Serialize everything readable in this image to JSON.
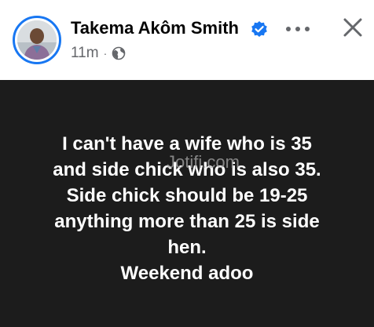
{
  "post": {
    "author_name": "Takema Akôm Smith",
    "timestamp": "11m",
    "separator": "·",
    "privacy_icon": "globe-icon",
    "verified_icon": "verified-badge-icon",
    "more_icon": "more-options-icon",
    "close_icon": "close-icon",
    "text_lines": [
      "I can't have a wife who is 35",
      "and side chick who is also 35.",
      "Side chick should be 19-25",
      "anything more than 25 is side",
      "hen.",
      "Weekend adoo"
    ],
    "watermark": "Jotifi.com"
  },
  "colors": {
    "accent": "#1877f2",
    "post_background": "#1c1c1c",
    "text_primary": "#050505",
    "text_secondary": "#65676b"
  }
}
